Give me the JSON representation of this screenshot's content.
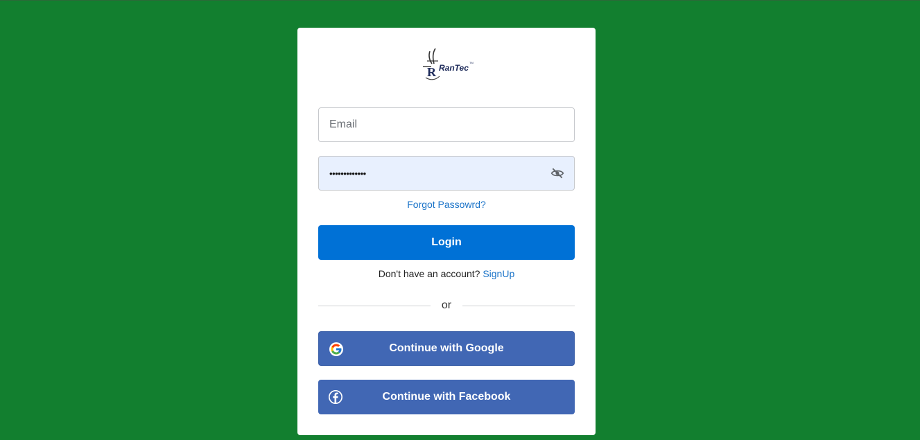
{
  "brand": {
    "logo_text": "RanTec",
    "logo_tm": "TM",
    "logo_letter": "R"
  },
  "login_form": {
    "email_placeholder": "Email",
    "password_value": "•••••••••••••",
    "forgot_label": "Forgot Passowrd?",
    "login_label": "Login",
    "no_account_text": "Don't have an account?",
    "signup_label": "SignUp",
    "divider_text": "or"
  },
  "social": {
    "google_label": "Continue with Google",
    "facebook_label": "Continue with Facebook"
  },
  "colors": {
    "page_background": "#127f2f",
    "primary_button": "#0071d6",
    "social_button": "#4167b4",
    "link": "#1a73c8"
  },
  "icons": {
    "password_toggle": "eye-off-icon",
    "google": "google-icon",
    "facebook": "facebook-icon"
  }
}
